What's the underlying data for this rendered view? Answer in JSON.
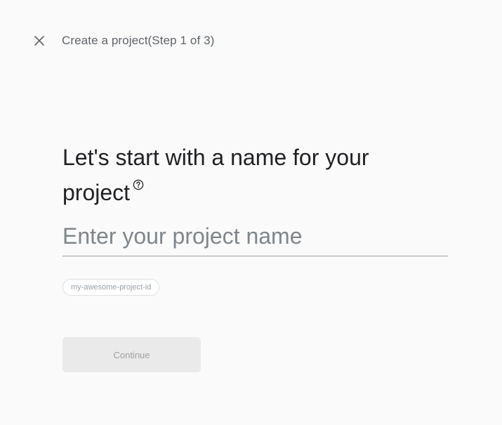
{
  "header": {
    "close_icon": "close-icon",
    "step_title": "Create a project(Step 1 of 3)"
  },
  "main": {
    "heading": "Let's start with a name for your project",
    "help_icon": "help-circle-icon",
    "project_name": {
      "value": "",
      "placeholder": "Enter your project name"
    },
    "project_id_chip": "my-awesome-project-id",
    "continue_label": "Continue",
    "continue_disabled": true
  },
  "colors": {
    "background": "#fafafa",
    "text_primary": "#202124",
    "text_secondary": "#5f6368",
    "button_disabled_bg": "#eaeaea",
    "button_disabled_text": "#a0a0a0"
  }
}
